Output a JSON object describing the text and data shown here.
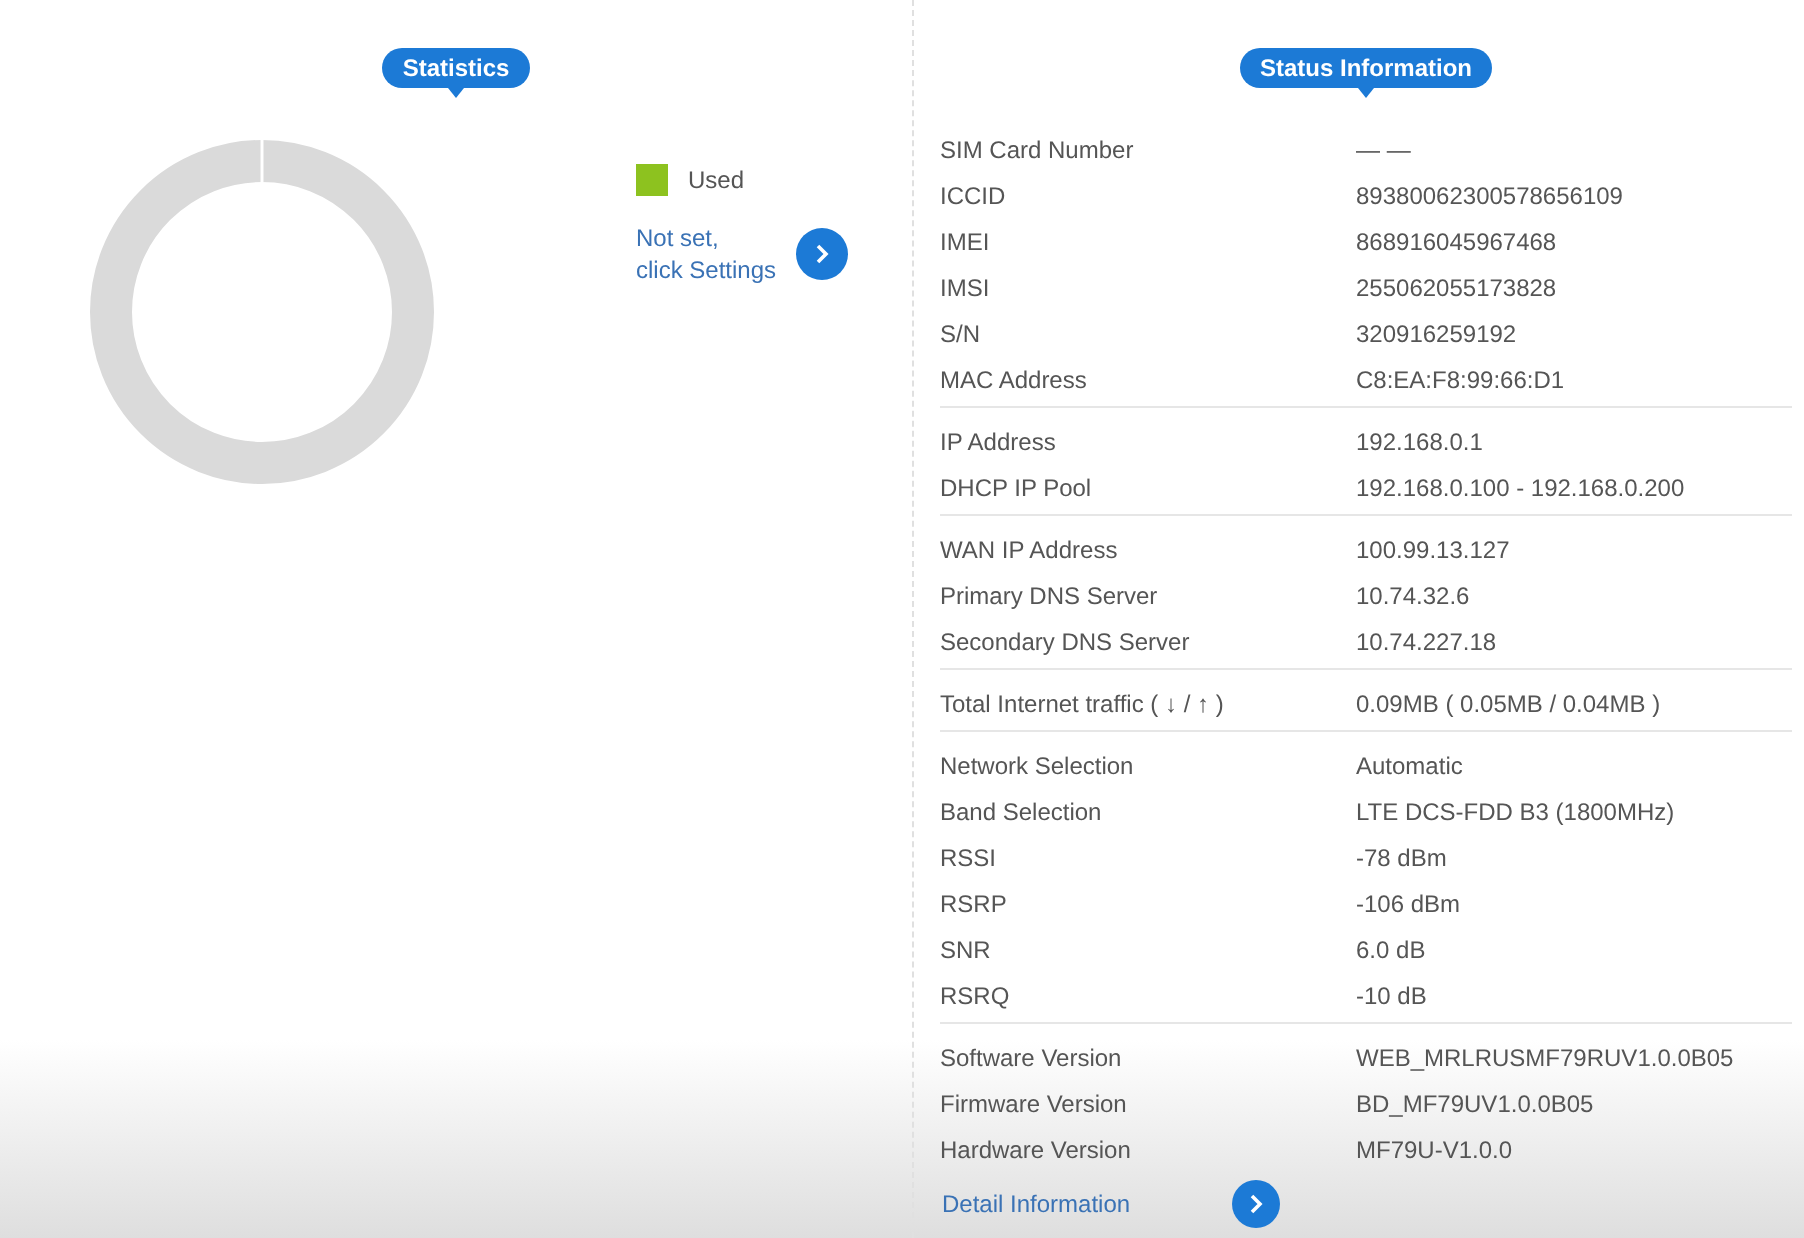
{
  "statistics": {
    "title": "Statistics",
    "legend": [
      {
        "label": "Used"
      }
    ],
    "notice": [
      "Not set,",
      "click Settings"
    ]
  },
  "status": {
    "title": "Status Information",
    "groups": [
      [
        {
          "label": "SIM Card Number",
          "value": "— —"
        },
        {
          "label": "ICCID",
          "value": "89380062300578656109"
        },
        {
          "label": "IMEI",
          "value": "868916045967468"
        },
        {
          "label": "IMSI",
          "value": "255062055173828"
        },
        {
          "label": "S/N",
          "value": "320916259192"
        },
        {
          "label": "MAC Address",
          "value": "C8:EA:F8:99:66:D1"
        }
      ],
      [
        {
          "label": "IP Address",
          "value": "192.168.0.1"
        },
        {
          "label": "DHCP IP Pool",
          "value": "192.168.0.100 - 192.168.0.200"
        }
      ],
      [
        {
          "label": "WAN IP Address",
          "value": "100.99.13.127"
        },
        {
          "label": "Primary DNS Server",
          "value": "10.74.32.6"
        },
        {
          "label": "Secondary DNS Server",
          "value": "10.74.227.18"
        }
      ],
      [
        {
          "label": "Total Internet traffic ( ↓ / ↑ )",
          "value": "0.09MB ( 0.05MB / 0.04MB )"
        }
      ],
      [
        {
          "label": "Network Selection",
          "value": "Automatic"
        },
        {
          "label": "Band Selection",
          "value": "LTE DCS-FDD B3 (1800MHz)"
        },
        {
          "label": "RSSI",
          "value": "-78 dBm"
        },
        {
          "label": "RSRP",
          "value": "-106 dBm"
        },
        {
          "label": "SNR",
          "value": "6.0 dB"
        },
        {
          "label": "RSRQ",
          "value": "-10 dB"
        }
      ],
      [
        {
          "label": "Software Version",
          "value": "WEB_MRLRUSMF79RUV1.0.0B05"
        },
        {
          "label": "Firmware Version",
          "value": "BD_MF79UV1.0.0B05"
        },
        {
          "label": "Hardware Version",
          "value": "MF79U-V1.0.0"
        }
      ]
    ],
    "detail_link": "Detail Information"
  }
}
